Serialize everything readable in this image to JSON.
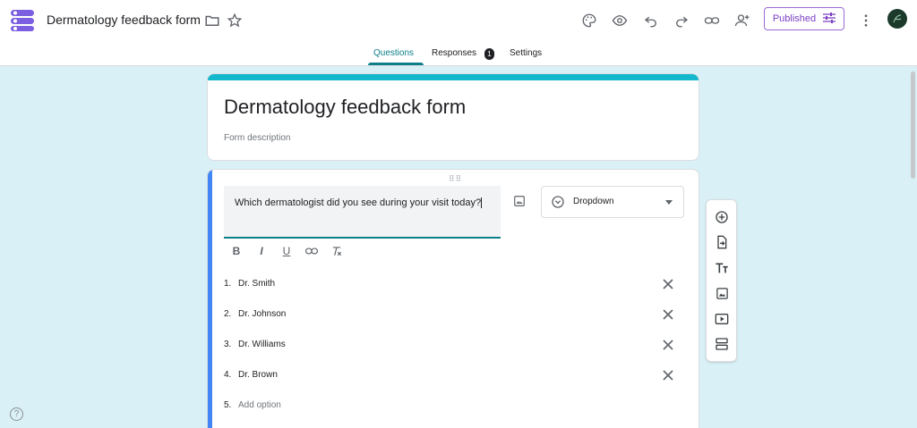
{
  "header": {
    "doc_title": "Dermatology feedback form",
    "published_label": "Published"
  },
  "tabs": [
    {
      "label": "Questions"
    },
    {
      "label": "Responses"
    },
    {
      "label": "Settings"
    }
  ],
  "responses_count": "1",
  "form": {
    "title": "Dermatology feedback form",
    "description_placeholder": "Form description"
  },
  "question": {
    "text": "Which dermatologist did you see during your visit today?",
    "type": "Dropdown",
    "options": [
      {
        "num": "1.",
        "label": "Dr. Smith"
      },
      {
        "num": "2.",
        "label": "Dr. Johnson"
      },
      {
        "num": "3.",
        "label": "Dr. Williams"
      },
      {
        "num": "4.",
        "label": "Dr. Brown"
      }
    ],
    "add_option": {
      "num": "5.",
      "label": "Add option"
    }
  },
  "format_buttons": {
    "bold": "B",
    "italic": "I",
    "underline": "U"
  },
  "colors": {
    "accent": "#0c7f8a",
    "header_strip": "#14b8cc",
    "focus_bar": "#4285f4",
    "background": "#d9f1f6",
    "published": "#7b3fc4"
  },
  "icons": [
    "forms-logo-icon",
    "folder-icon",
    "star-icon",
    "palette-icon",
    "eye-icon",
    "undo-icon",
    "redo-icon",
    "link-icon",
    "add-person-icon",
    "tune-icon",
    "more-vert-icon",
    "image-icon",
    "dropdown-circle-icon",
    "close-icon",
    "add-circle-icon",
    "import-icon",
    "title-icon",
    "video-icon",
    "section-icon",
    "help-icon"
  ]
}
